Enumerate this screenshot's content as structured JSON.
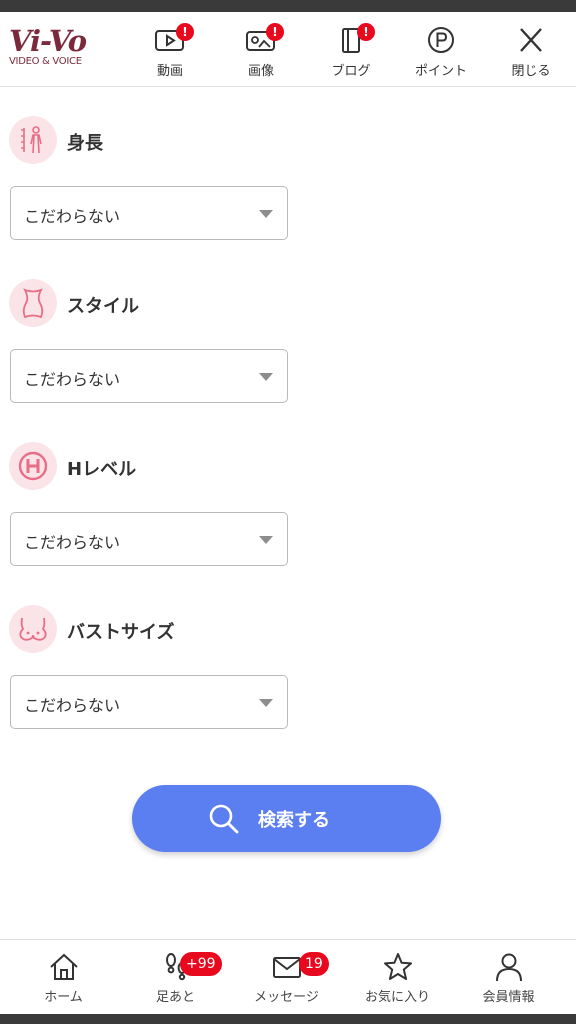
{
  "colors": {
    "accent": "#5b7ff0",
    "brand": "#7a2a3c",
    "alert": "#e8091f",
    "icon_bg": "#fbe4e8",
    "icon_line": "#e86d86"
  },
  "logo": {
    "main": "Vi-Vo",
    "sub": "VIDEO & VOICE"
  },
  "header_nav": [
    {
      "label": "動画",
      "icon": "video-play-icon",
      "alert": "!"
    },
    {
      "label": "画像",
      "icon": "image-gallery-icon",
      "alert": "!"
    },
    {
      "label": "ブログ",
      "icon": "blog-book-icon",
      "alert": "!"
    },
    {
      "label": "ポイント",
      "icon": "point-p-icon"
    },
    {
      "label": "閉じる",
      "icon": "close-icon"
    }
  ],
  "filters": [
    {
      "title": "身長",
      "icon": "height-person-icon",
      "value": "こだわらない"
    },
    {
      "title": "スタイル",
      "icon": "body-style-icon",
      "value": "こだわらない"
    },
    {
      "title": "Hレベル",
      "icon": "h-level-icon",
      "value": "こだわらない"
    },
    {
      "title": "バストサイズ",
      "icon": "bust-icon",
      "value": "こだわらない"
    }
  ],
  "search_button": {
    "label": "検索する",
    "icon": "search-icon"
  },
  "tabs": [
    {
      "label": "ホーム",
      "icon": "home-icon"
    },
    {
      "label": "足あと",
      "icon": "footprints-icon",
      "badge": "+99"
    },
    {
      "label": "メッセージ",
      "icon": "mail-icon",
      "badge": "19"
    },
    {
      "label": "お気に入り",
      "icon": "star-icon"
    },
    {
      "label": "会員情報",
      "icon": "user-icon"
    }
  ]
}
